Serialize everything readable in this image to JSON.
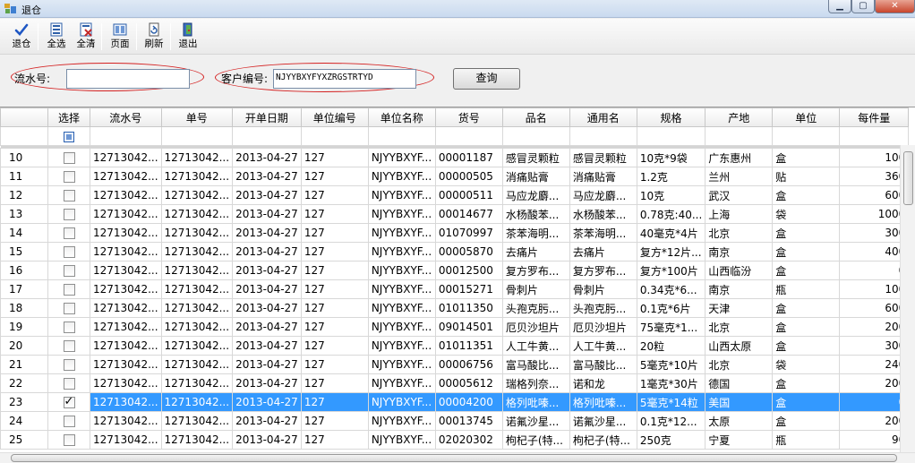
{
  "window": {
    "title": "退仓"
  },
  "toolbar": {
    "buttons": [
      {
        "label": "退仓",
        "icon": "check-icon"
      },
      {
        "label": "全选",
        "icon": "select-all-icon"
      },
      {
        "label": "全清",
        "icon": "clear-all-icon"
      },
      {
        "label": "页面",
        "icon": "page-icon"
      },
      {
        "label": "刷新",
        "icon": "refresh-icon"
      },
      {
        "label": "退出",
        "icon": "exit-icon"
      }
    ]
  },
  "search": {
    "serial_label": "流水号:",
    "serial_value": "",
    "customer_label": "客户编号:",
    "customer_value": "NJYYBXYFYXZRGSTRTYD",
    "query_label": "查询"
  },
  "grid": {
    "columns": [
      "",
      "选择",
      "流水号",
      "单号",
      "开单日期",
      "单位编号",
      "单位名称",
      "货号",
      "品名",
      "通用名",
      "规格",
      "产地",
      "单位",
      "每件量"
    ],
    "rows": [
      {
        "no": "10",
        "checked": false,
        "serial": "12713042...",
        "order": "12713042...",
        "date": "2013-04-27",
        "unit_code": "127",
        "unit_name": "NJYYBXYF...",
        "item_no": "00001187",
        "name": "感冒灵颗粒",
        "generic": "感冒灵颗粒",
        "spec": "10克*9袋",
        "origin": "广东惠州",
        "unit": "盒",
        "qty": "100",
        "selected": false
      },
      {
        "no": "11",
        "checked": false,
        "serial": "12713042...",
        "order": "12713042...",
        "date": "2013-04-27",
        "unit_code": "127",
        "unit_name": "NJYYBXYF...",
        "item_no": "00000505",
        "name": "消痛贴膏",
        "generic": "消痛贴膏",
        "spec": "1.2克",
        "origin": "兰州",
        "unit": "贴",
        "qty": "360",
        "selected": false
      },
      {
        "no": "12",
        "checked": false,
        "serial": "12713042...",
        "order": "12713042...",
        "date": "2013-04-27",
        "unit_code": "127",
        "unit_name": "NJYYBXYF...",
        "item_no": "00000511",
        "name": "马应龙麝...",
        "generic": "马应龙麝...",
        "spec": "10克",
        "origin": "武汉",
        "unit": "盒",
        "qty": "600",
        "selected": false
      },
      {
        "no": "13",
        "checked": false,
        "serial": "12713042...",
        "order": "12713042...",
        "date": "2013-04-27",
        "unit_code": "127",
        "unit_name": "NJYYBXYF...",
        "item_no": "00014677",
        "name": "水杨酸苯...",
        "generic": "水杨酸苯...",
        "spec": "0.78克:40...",
        "origin": "上海",
        "unit": "袋",
        "qty": "1000",
        "selected": false
      },
      {
        "no": "14",
        "checked": false,
        "serial": "12713042...",
        "order": "12713042...",
        "date": "2013-04-27",
        "unit_code": "127",
        "unit_name": "NJYYBXYF...",
        "item_no": "01070997",
        "name": "茶苯海明...",
        "generic": "茶苯海明...",
        "spec": "40毫克*4片",
        "origin": "北京",
        "unit": "盒",
        "qty": "300",
        "selected": false
      },
      {
        "no": "15",
        "checked": false,
        "serial": "12713042...",
        "order": "12713042...",
        "date": "2013-04-27",
        "unit_code": "127",
        "unit_name": "NJYYBXYF...",
        "item_no": "00005870",
        "name": "去痛片",
        "generic": "去痛片",
        "spec": "复方*12片...",
        "origin": "南京",
        "unit": "盒",
        "qty": "400",
        "selected": false
      },
      {
        "no": "16",
        "checked": false,
        "serial": "12713042...",
        "order": "12713042...",
        "date": "2013-04-27",
        "unit_code": "127",
        "unit_name": "NJYYBXYF...",
        "item_no": "00012500",
        "name": "复方罗布...",
        "generic": "复方罗布...",
        "spec": "复方*100片",
        "origin": "山西临汾",
        "unit": "盒",
        "qty": "0",
        "selected": false
      },
      {
        "no": "17",
        "checked": false,
        "serial": "12713042...",
        "order": "12713042...",
        "date": "2013-04-27",
        "unit_code": "127",
        "unit_name": "NJYYBXYF...",
        "item_no": "00015271",
        "name": "骨刺片",
        "generic": "骨刺片",
        "spec": "0.34克*6...",
        "origin": "南京",
        "unit": "瓶",
        "qty": "100",
        "selected": false
      },
      {
        "no": "18",
        "checked": false,
        "serial": "12713042...",
        "order": "12713042...",
        "date": "2013-04-27",
        "unit_code": "127",
        "unit_name": "NJYYBXYF...",
        "item_no": "01011350",
        "name": "头孢克肟...",
        "generic": "头孢克肟...",
        "spec": "0.1克*6片",
        "origin": "天津",
        "unit": "盒",
        "qty": "600",
        "selected": false
      },
      {
        "no": "19",
        "checked": false,
        "serial": "12713042...",
        "order": "12713042...",
        "date": "2013-04-27",
        "unit_code": "127",
        "unit_name": "NJYYBXYF...",
        "item_no": "09014501",
        "name": "厄贝沙坦片",
        "generic": "厄贝沙坦片",
        "spec": "75毫克*1...",
        "origin": "北京",
        "unit": "盒",
        "qty": "200",
        "selected": false
      },
      {
        "no": "20",
        "checked": false,
        "serial": "12713042...",
        "order": "12713042...",
        "date": "2013-04-27",
        "unit_code": "127",
        "unit_name": "NJYYBXYF...",
        "item_no": "01011351",
        "name": "人工牛黄...",
        "generic": "人工牛黄...",
        "spec": "20粒",
        "origin": "山西太原",
        "unit": "盒",
        "qty": "300",
        "selected": false
      },
      {
        "no": "21",
        "checked": false,
        "serial": "12713042...",
        "order": "12713042...",
        "date": "2013-04-27",
        "unit_code": "127",
        "unit_name": "NJYYBXYF...",
        "item_no": "00006756",
        "name": "富马酸比...",
        "generic": "富马酸比...",
        "spec": "5毫克*10片",
        "origin": "北京",
        "unit": "袋",
        "qty": "240",
        "selected": false
      },
      {
        "no": "22",
        "checked": false,
        "serial": "12713042...",
        "order": "12713042...",
        "date": "2013-04-27",
        "unit_code": "127",
        "unit_name": "NJYYBXYF...",
        "item_no": "00005612",
        "name": "瑞格列奈...",
        "generic": "诺和龙",
        "spec": "1毫克*30片",
        "origin": "德国",
        "unit": "盒",
        "qty": "200",
        "selected": false
      },
      {
        "no": "23",
        "checked": true,
        "serial": "12713042...",
        "order": "12713042...",
        "date": "2013-04-27",
        "unit_code": "127",
        "unit_name": "NJYYBXYF...",
        "item_no": "00004200",
        "name": "格列吡嗪...",
        "generic": "格列吡嗪...",
        "spec": "5毫克*14粒",
        "origin": "美国",
        "unit": "盒",
        "qty": "0",
        "selected": true
      },
      {
        "no": "24",
        "checked": false,
        "serial": "12713042...",
        "order": "12713042...",
        "date": "2013-04-27",
        "unit_code": "127",
        "unit_name": "NJYYBXYF...",
        "item_no": "00013745",
        "name": "诺氟沙星...",
        "generic": "诺氟沙星...",
        "spec": "0.1克*12...",
        "origin": "太原",
        "unit": "盒",
        "qty": "200",
        "selected": false
      },
      {
        "no": "25",
        "checked": false,
        "serial": "12713042...",
        "order": "12713042...",
        "date": "2013-04-27",
        "unit_code": "127",
        "unit_name": "NJYYBXYF...",
        "item_no": "02020302",
        "name": "枸杞子(特...",
        "generic": "枸杞子(特...",
        "spec": "250克",
        "origin": "宁夏",
        "unit": "瓶",
        "qty": "90",
        "selected": false
      }
    ]
  },
  "colors": {
    "selection": "#3399ff",
    "annotation_ellipse": "#d42020"
  }
}
